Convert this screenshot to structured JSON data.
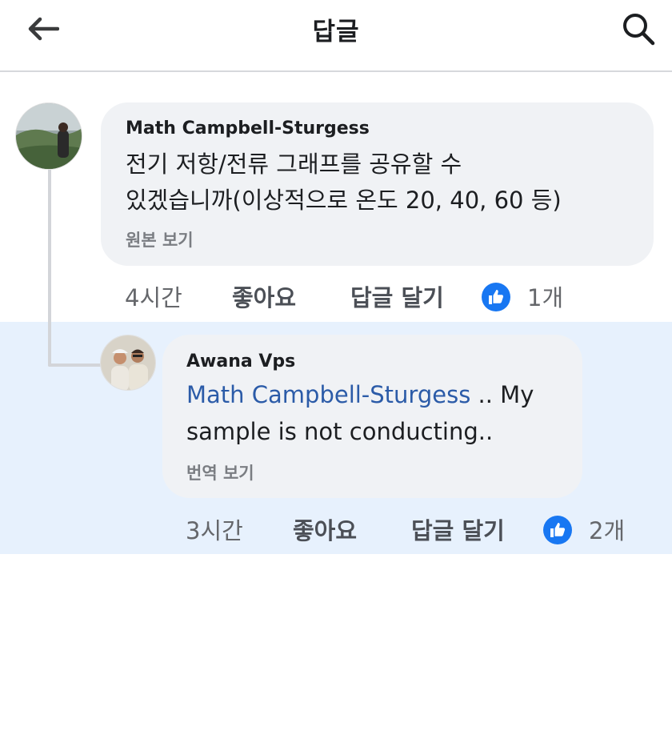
{
  "header": {
    "title": "답글",
    "back_icon": "arrow-left-icon",
    "search_icon": "search-icon"
  },
  "comment": {
    "author": "Math Campbell-Sturgess",
    "text_line1": "전기 저항/전류 그래프를 공유할 수",
    "text_line2": "있겠습니까(이상적으로 온도 20, 40, 60 등)",
    "see_original": "원본 보기",
    "time": "4시간",
    "like_label": "좋아요",
    "reply_label": "답글 달기",
    "reaction_count": "1개"
  },
  "reply": {
    "author": "Awana Vps",
    "mention": "Math Campbell-Sturgess",
    "text_inline": " .. My",
    "text_line2": "sample is not conducting..",
    "see_translation": "번역 보기",
    "time": "3시간",
    "like_label": "좋아요",
    "reply_label": "답글 달기",
    "reaction_count": "2개"
  },
  "colors": {
    "accent": "#1877f2",
    "mention": "#2b5ba8",
    "bubble": "#f0f2f5",
    "highlight": "#e7f1fd"
  }
}
